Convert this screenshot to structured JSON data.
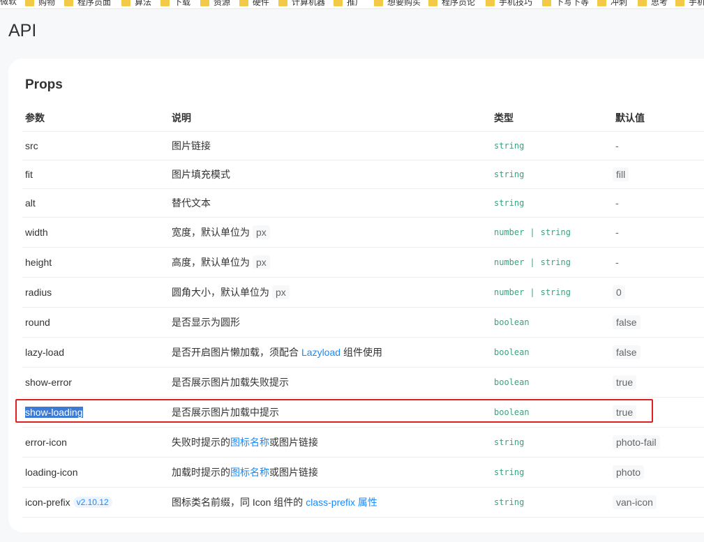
{
  "bookmarks": [
    "微软",
    "购物",
    "程序员面",
    "算法",
    "下载",
    "资源",
    "硬件",
    "计算机器",
    "推广",
    "想要购买",
    "程序员论",
    "手机技巧",
    "下写下等",
    "冲刺",
    "思考",
    "手机"
  ],
  "page_title": "API",
  "section_title": "Props",
  "headers": {
    "param": "参数",
    "desc": "说明",
    "type": "类型",
    "default": "默认值"
  },
  "rows": [
    {
      "param": "src",
      "desc": "图片链接",
      "type": [
        "string"
      ],
      "default": "-"
    },
    {
      "param": "fit",
      "desc": "图片填充模式",
      "type": [
        "string"
      ],
      "default": "fill"
    },
    {
      "param": "alt",
      "desc": "替代文本",
      "type": [
        "string"
      ],
      "default": "-"
    },
    {
      "param": "width",
      "desc": "宽度，默认单位为",
      "desc_code": "px",
      "type": [
        "number",
        "string"
      ],
      "default": "-"
    },
    {
      "param": "height",
      "desc": "高度，默认单位为",
      "desc_code": "px",
      "type": [
        "number",
        "string"
      ],
      "default": "-"
    },
    {
      "param": "radius",
      "desc": "圆角大小，默认单位为",
      "desc_code": "px",
      "type": [
        "number",
        "string"
      ],
      "default": "0"
    },
    {
      "param": "round",
      "desc": "是否显示为圆形",
      "type": [
        "boolean"
      ],
      "default": "false"
    },
    {
      "param": "lazy-load",
      "desc": "是否开启图片懒加载，须配合",
      "desc_link": "Lazyload",
      "desc_tail": "组件使用",
      "type": [
        "boolean"
      ],
      "default": "false"
    },
    {
      "param": "show-error",
      "desc": "是否展示图片加载失败提示",
      "type": [
        "boolean"
      ],
      "default": "true"
    },
    {
      "param": "show-loading",
      "desc": "是否展示图片加载中提示",
      "type": [
        "boolean"
      ],
      "default": "true",
      "selected": true
    },
    {
      "param": "error-icon",
      "desc": "失败时提示的",
      "desc_link": "图标名称",
      "desc_tail": "或图片链接",
      "type": [
        "string"
      ],
      "default": "photo-fail"
    },
    {
      "param": "loading-icon",
      "desc": "加载时提示的",
      "desc_link": "图标名称",
      "desc_tail": "或图片链接",
      "type": [
        "string"
      ],
      "default": "photo"
    },
    {
      "param": "icon-prefix",
      "param_tag": "v2.10.12",
      "desc": "图标类名前缀，同 Icon 组件的",
      "desc_link": "class-prefix 属性",
      "type": [
        "string"
      ],
      "default": "van-icon"
    }
  ]
}
